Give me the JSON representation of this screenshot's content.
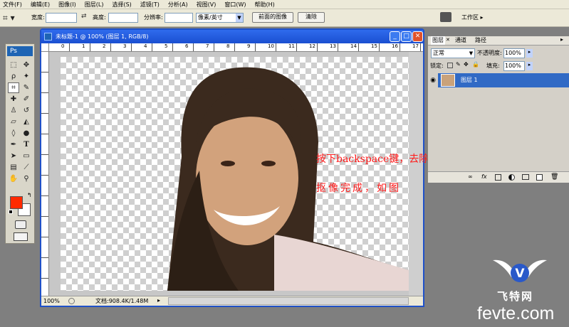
{
  "menu": [
    "文件(F)",
    "编辑(E)",
    "图像(I)",
    "图层(L)",
    "选择(S)",
    "滤镜(T)",
    "分析(A)",
    "视图(V)",
    "窗口(W)",
    "帮助(H)"
  ],
  "options": {
    "width_label": "宽度:",
    "height_label": "高度:",
    "resolution_label": "分辨率:",
    "unit_value": "像素/英寸",
    "front_image_button": "前面的图像",
    "clear_button": "清除",
    "workspace_label": "工作区 ▸"
  },
  "toolbox": {
    "logo": "Ps",
    "foreground_color": "#ff2a00",
    "background_color": "#ffffff"
  },
  "document": {
    "title": "未标题-1 @ 100% (图层 1, RGB/8)",
    "ruler_ticks": [
      "0",
      "1",
      "2",
      "3",
      "4",
      "5",
      "6",
      "7",
      "8",
      "9",
      "10",
      "11",
      "12",
      "13",
      "14",
      "15",
      "16",
      "17"
    ],
    "zoom": "100%",
    "doc_size": "文档:908.4K/1.48M",
    "annotation_line1": "按下backspace键，去除背景",
    "annotation_line2": "抠像完成，如图"
  },
  "layers_panel": {
    "tabs": [
      "图层",
      "通道",
      "路径"
    ],
    "blend_mode": "正常",
    "opacity_label": "不透明度:",
    "opacity_value": "100%",
    "lock_label": "锁定:",
    "fill_label": "填充:",
    "fill_value": "100%",
    "layer_name": "图层 1"
  },
  "watermark": {
    "brand_cn": "飞特网",
    "domain": "fevte.com"
  }
}
